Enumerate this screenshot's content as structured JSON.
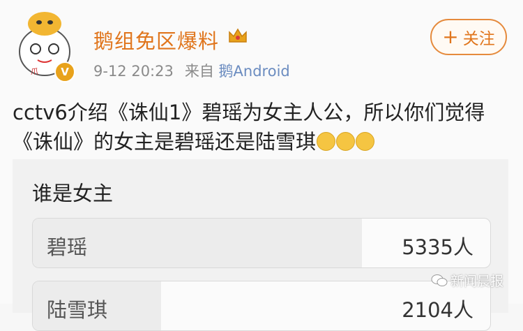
{
  "post": {
    "username": "鹅组免区爆料",
    "time": "9-12 20:23",
    "source_prefix": "来自",
    "source_app": "鹅Android",
    "follow_label": "关注",
    "follow_icon": "plus-icon",
    "content": "cctv6介绍《诛仙1》碧瑶为女主人公，所以你们觉得《诛仙》的女主是碧瑶还是陆雪琪",
    "emojis": [
      "hungry-emoji-icon",
      "smile-emoji-icon",
      "smile-emoji-icon"
    ]
  },
  "poll": {
    "title": "谁是女主",
    "options": [
      {
        "label": "碧瑶",
        "count": "5335人",
        "share": 0.72
      },
      {
        "label": "陆雪琪",
        "count": "2104人",
        "share": 0.28
      }
    ]
  },
  "watermark": {
    "text": "新闻晨报",
    "icon": "wechat-icon"
  },
  "colors": {
    "accent": "#e0751c",
    "link": "#6b8cc0",
    "meta": "#8a8a8a"
  }
}
